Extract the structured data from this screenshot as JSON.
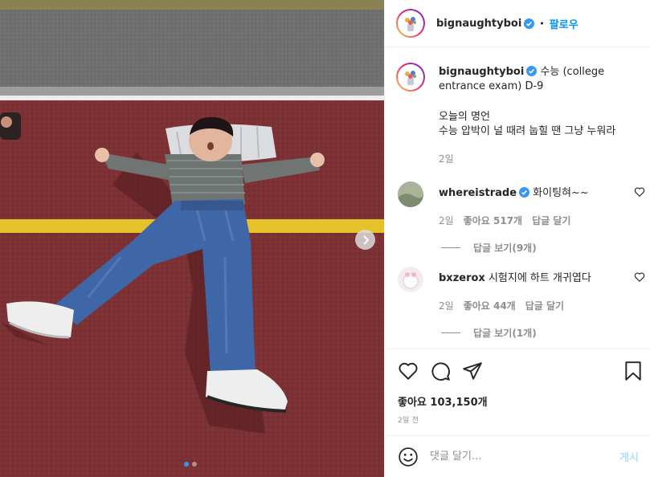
{
  "post": {
    "username": "bignaughtyboi",
    "follow_label": "팔로우",
    "separator": "•",
    "caption_title": "수능 (college entrance exam) D-9",
    "caption_lines": [
      "오늘의 명언",
      "수능 압박이 널 때려 눕힐 땐 그냥 누워라"
    ],
    "caption_time": "2일",
    "likes": "좋아요 103,150개",
    "posted": "2일 전",
    "carousel_index": 1,
    "carousel_total": 2
  },
  "comments": [
    {
      "username": "whereistrade",
      "verified": true,
      "text": "화이팅혀~~",
      "time": "2일",
      "likes": "좋아요 517개",
      "reply": "답글 달기",
      "view_replies": "답글 보기(9개)"
    },
    {
      "username": "bxzerox",
      "verified": false,
      "text": "시험지에 하트 개귀엽다",
      "time": "2일",
      "likes": "좋아요 44개",
      "reply": "답글 달기",
      "view_replies": "답글 보기(1개)"
    }
  ],
  "composer": {
    "placeholder": "댓글 달기...",
    "post_label": "게시"
  },
  "icons": {
    "like": "heart-icon",
    "comment": "comment-icon",
    "share": "share-icon",
    "save": "bookmark-icon",
    "emoji": "emoji-icon",
    "verified": "verified-badge-icon",
    "next": "chevron-right-icon"
  },
  "colors": {
    "accent": "#0095f6",
    "verified": "#3897f0",
    "track": "#7a2f32",
    "lane_line": "#e6c22a",
    "muted": "#8e8e8e"
  }
}
